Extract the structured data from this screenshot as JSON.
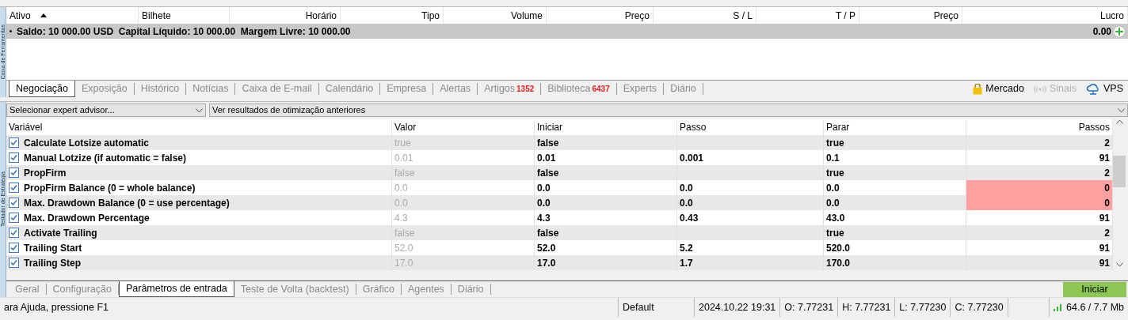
{
  "toolbox": {
    "side_label": "Caixa de Ferramentas",
    "columns": [
      {
        "label": "Ativo",
        "sorted": true
      },
      {
        "label": "Bilhete",
        "sorted": false
      },
      {
        "label": "Horário",
        "sorted": false
      },
      {
        "label": "Tipo",
        "sorted": false
      },
      {
        "label": "Volume",
        "sorted": false
      },
      {
        "label": "Preço",
        "sorted": false
      },
      {
        "label": "S / L",
        "sorted": false
      },
      {
        "label": "T / P",
        "sorted": false
      },
      {
        "label": "Preço",
        "sorted": false
      },
      {
        "label": "Lucro",
        "sorted": false
      }
    ],
    "balance_row": {
      "text": "Saldo: 10 000.00 USD  Capital Líquido: 10 000.00  Margem Livre: 10 000.00",
      "profit": "0.00"
    },
    "tabs": [
      {
        "label": "Negociação",
        "selected": true
      },
      {
        "label": "Exposição",
        "selected": false
      },
      {
        "label": "Histórico",
        "selected": false
      },
      {
        "label": "Notícias",
        "selected": false
      },
      {
        "label": "Caixa de E-mail",
        "selected": false
      },
      {
        "label": "Calendário",
        "selected": false
      },
      {
        "label": "Empresa",
        "selected": false
      },
      {
        "label": "Alertas",
        "selected": false
      },
      {
        "label": "Artigos",
        "badge": "1352",
        "selected": false
      },
      {
        "label": "Biblioteca",
        "badge": "6437",
        "selected": false
      },
      {
        "label": "Experts",
        "selected": false
      },
      {
        "label": "Diário",
        "selected": false
      }
    ],
    "services": [
      {
        "label": "Mercado",
        "kind": "market",
        "disabled": false
      },
      {
        "label": "Sinais",
        "kind": "signals",
        "disabled": true
      },
      {
        "label": "VPS",
        "kind": "vps",
        "disabled": false
      }
    ]
  },
  "tester": {
    "side_label": "Testador de Estratégia",
    "expert_select": {
      "value": "Selecionar expert advisor..."
    },
    "history_select": {
      "value": "Ver resultados de otimização anteriores"
    },
    "columns": [
      "Variável",
      "Valor",
      "Iniciar",
      "Passo",
      "Parar",
      "Passos"
    ],
    "rows": [
      {
        "checked": true,
        "name": "Calculate Lotsize automatic",
        "value": "true",
        "start": "false",
        "step": "",
        "stop": "true",
        "steps": "2",
        "warning": false
      },
      {
        "checked": true,
        "name": "Manual Lotzize (if automatic = false)",
        "value": "0.01",
        "start": "0.01",
        "step": "0.001",
        "stop": "0.1",
        "steps": "91",
        "warning": false
      },
      {
        "checked": true,
        "name": "PropFirm",
        "value": "false",
        "start": "false",
        "step": "",
        "stop": "true",
        "steps": "2",
        "warning": false
      },
      {
        "checked": true,
        "name": "PropFirm Balance (0 = whole balance)",
        "value": "0.0",
        "start": "0.0",
        "step": "0.0",
        "stop": "0.0",
        "steps": "0",
        "warning": true
      },
      {
        "checked": true,
        "name": "Max. Drawdown Balance (0 = use percentage)",
        "value": "0.0",
        "start": "0.0",
        "step": "0.0",
        "stop": "0.0",
        "steps": "0",
        "warning": true
      },
      {
        "checked": true,
        "name": "Max. Drawdown Percentage",
        "value": "4.3",
        "start": "4.3",
        "step": "0.43",
        "stop": "43.0",
        "steps": "91",
        "warning": false
      },
      {
        "checked": true,
        "name": "Activate Trailing",
        "value": "false",
        "start": "false",
        "step": "",
        "stop": "true",
        "steps": "2",
        "warning": false
      },
      {
        "checked": true,
        "name": "Trailing Start",
        "value": "52.0",
        "start": "52.0",
        "step": "5.2",
        "stop": "520.0",
        "steps": "91",
        "warning": false
      },
      {
        "checked": true,
        "name": "Trailing Step",
        "value": "17.0",
        "start": "17.0",
        "step": "1.7",
        "stop": "170.0",
        "steps": "91",
        "warning": false
      }
    ],
    "tabs": [
      {
        "label": "Geral",
        "selected": false
      },
      {
        "label": "Configuração",
        "selected": false
      },
      {
        "label": "Parâmetros de entrada",
        "selected": true
      },
      {
        "label": "Teste de Volta (backtest)",
        "selected": false
      },
      {
        "label": "Gráfico",
        "selected": false
      },
      {
        "label": "Agentes",
        "selected": false
      },
      {
        "label": "Diário",
        "selected": false
      }
    ],
    "start_button": "Iniciar"
  },
  "status_bar": {
    "help": "ara Ajuda, pressione F1",
    "profile": "Default",
    "datetime": "2024.10.22 19:31",
    "open": "O: 7.77231",
    "high": "H: 7.77231",
    "low": "L: 7.77230",
    "close": "C: 7.77230",
    "traffic": "64.6 / 7.7 Mb"
  }
}
